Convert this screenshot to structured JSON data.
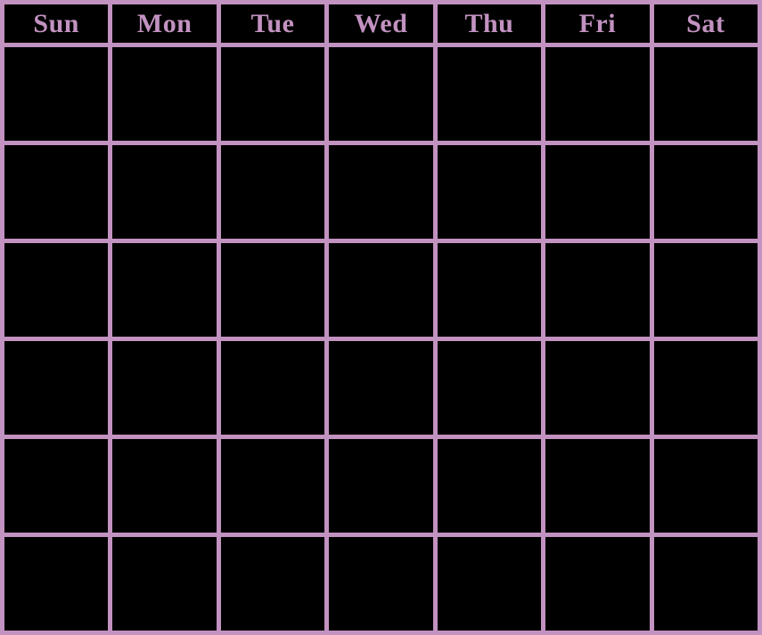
{
  "calendar": {
    "grid_label": "monthly-calendar-grid",
    "colors": {
      "line": "#c292c0",
      "background": "#000000",
      "header_text": "#c292c0"
    },
    "header": {
      "days": [
        {
          "label": "Sun"
        },
        {
          "label": "Mon"
        },
        {
          "label": "Tue"
        },
        {
          "label": "Wed"
        },
        {
          "label": "Thu"
        },
        {
          "label": "Fri"
        },
        {
          "label": "Sat"
        }
      ]
    },
    "weeks": [
      {
        "cells": [
          {
            "day": ""
          },
          {
            "day": ""
          },
          {
            "day": ""
          },
          {
            "day": ""
          },
          {
            "day": ""
          },
          {
            "day": ""
          },
          {
            "day": ""
          }
        ]
      },
      {
        "cells": [
          {
            "day": ""
          },
          {
            "day": ""
          },
          {
            "day": ""
          },
          {
            "day": ""
          },
          {
            "day": ""
          },
          {
            "day": ""
          },
          {
            "day": ""
          }
        ]
      },
      {
        "cells": [
          {
            "day": ""
          },
          {
            "day": ""
          },
          {
            "day": ""
          },
          {
            "day": ""
          },
          {
            "day": ""
          },
          {
            "day": ""
          },
          {
            "day": ""
          }
        ]
      },
      {
        "cells": [
          {
            "day": ""
          },
          {
            "day": ""
          },
          {
            "day": ""
          },
          {
            "day": ""
          },
          {
            "day": ""
          },
          {
            "day": ""
          },
          {
            "day": ""
          }
        ]
      },
      {
        "cells": [
          {
            "day": ""
          },
          {
            "day": ""
          },
          {
            "day": ""
          },
          {
            "day": ""
          },
          {
            "day": ""
          },
          {
            "day": ""
          },
          {
            "day": ""
          }
        ]
      },
      {
        "cells": [
          {
            "day": ""
          },
          {
            "day": ""
          },
          {
            "day": ""
          },
          {
            "day": ""
          },
          {
            "day": ""
          },
          {
            "day": ""
          },
          {
            "day": ""
          }
        ]
      }
    ]
  }
}
